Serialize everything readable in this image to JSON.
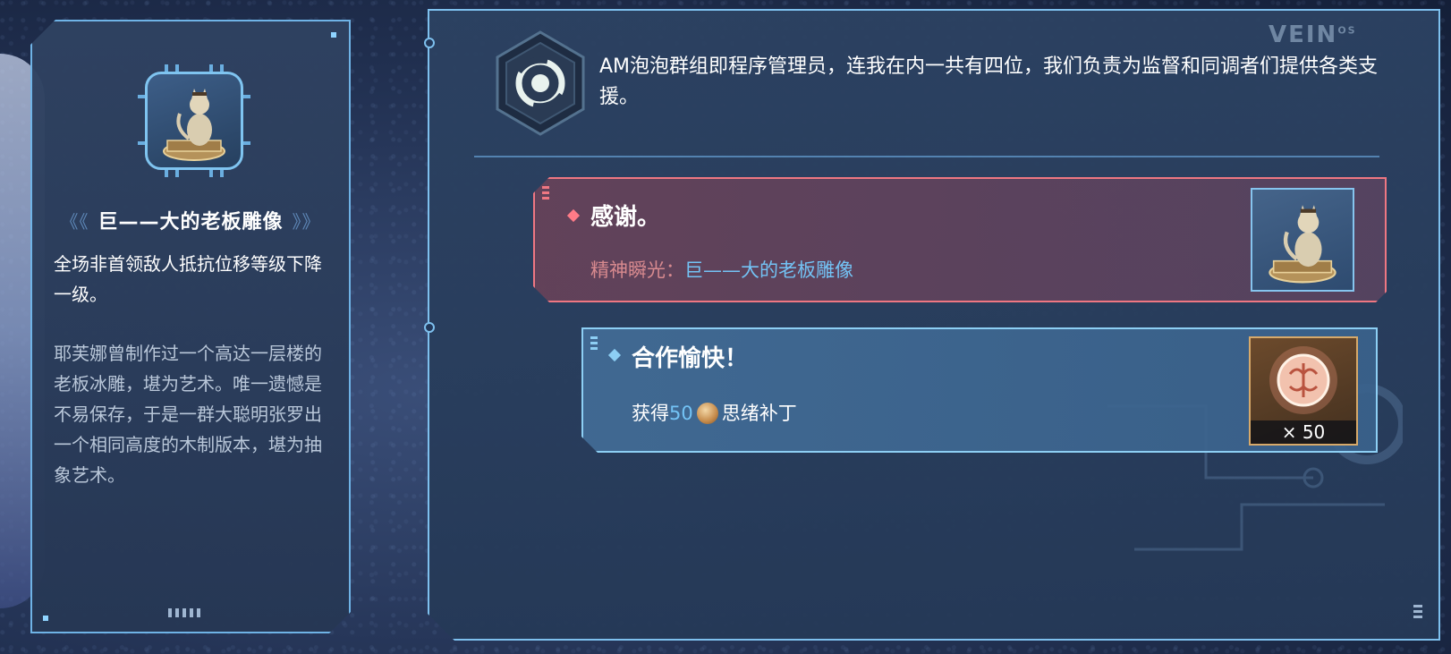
{
  "item_card": {
    "icon": "cat-statue-icon",
    "name": "巨——大的老板雕像",
    "name_left_deco": "《《",
    "name_right_deco": "》》",
    "effect": "全场非首领敌人抵抗位移等级下降一级。",
    "lore": "耶芙娜曾制作过一个高达一层楼的老板冰雕，堪为艺术。唯一遗憾是不易保存，于是一群大聪明张罗出一个相同高度的木制版本，堪为抽象艺术。"
  },
  "dialog": {
    "brand": "VEIN",
    "brand_suffix": "OS",
    "speaker_icon": "vortex-emblem-icon",
    "speaker_text": "AM泡泡群组即程序管理员，连我在内一共有四位，我们负责为监督和同调者们提供各类支援。",
    "options": [
      {
        "title": "感谢。",
        "sub_label": "精神瞬光：",
        "sub_value": "巨——大的老板雕像",
        "reward_icon": "cat-statue-icon",
        "accent": "#ef7782"
      },
      {
        "title": "合作愉快！",
        "sub_prefix": "获得",
        "sub_amount": "50",
        "sub_item": "思绪补丁",
        "reward_icon": "brain-patch-icon",
        "reward_count": "× 50",
        "accent": "#8dcff4"
      }
    ]
  }
}
